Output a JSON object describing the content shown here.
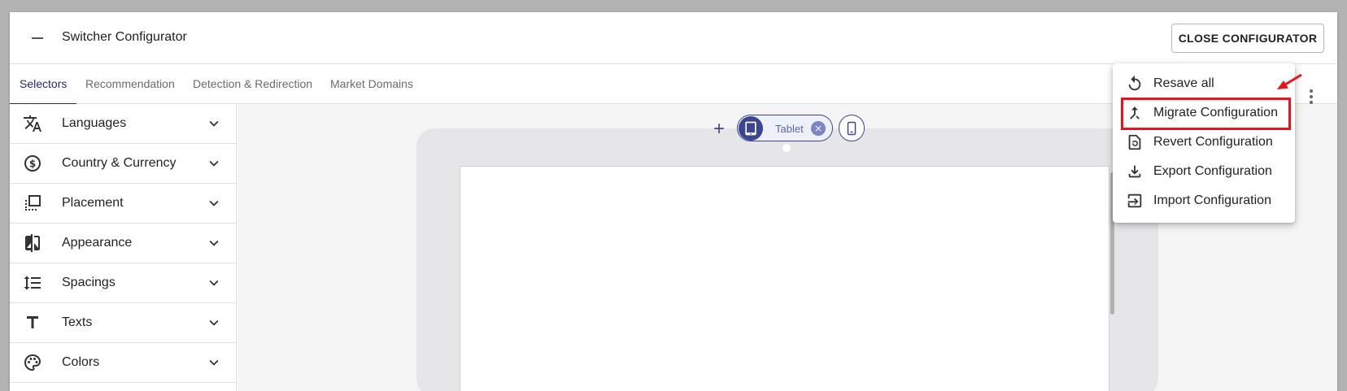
{
  "header": {
    "title": "Switcher Configurator",
    "close_label": "CLOSE CONFIGURATOR"
  },
  "tabs": [
    {
      "label": "Selectors",
      "active": true
    },
    {
      "label": "Recommendation",
      "active": false
    },
    {
      "label": "Detection & Redirection",
      "active": false
    },
    {
      "label": "Market Domains",
      "active": false
    }
  ],
  "sidebar": {
    "items": [
      {
        "label": "Languages",
        "icon": "translate-icon"
      },
      {
        "label": "Country & Currency",
        "icon": "currency-icon"
      },
      {
        "label": "Placement",
        "icon": "placement-icon"
      },
      {
        "label": "Appearance",
        "icon": "contrast-icon"
      },
      {
        "label": "Spacings",
        "icon": "line-spacing-icon"
      },
      {
        "label": "Texts",
        "icon": "text-icon"
      },
      {
        "label": "Colors",
        "icon": "palette-icon"
      }
    ]
  },
  "preview": {
    "device_label": "Tablet",
    "selected_device": "tablet"
  },
  "menu": {
    "items": [
      {
        "label": "Resave all",
        "icon": "refresh-icon"
      },
      {
        "label": "Migrate Configuration",
        "icon": "merge-icon",
        "highlighted": true
      },
      {
        "label": "Revert Configuration",
        "icon": "file-restore-icon"
      },
      {
        "label": "Export Configuration",
        "icon": "download-icon"
      },
      {
        "label": "Import Configuration",
        "icon": "import-icon"
      }
    ]
  },
  "colors": {
    "accent": "#1f2a6e",
    "chip": "#3c4690",
    "highlight": "#e8141c"
  }
}
